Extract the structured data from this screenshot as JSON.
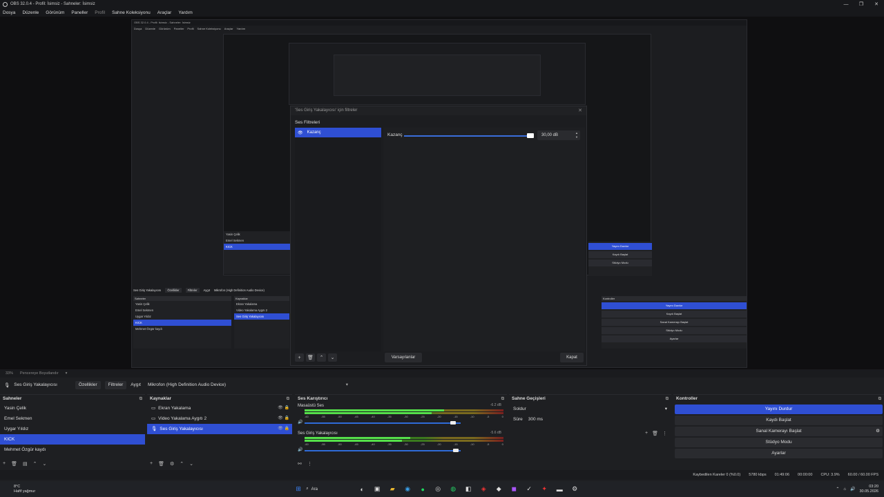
{
  "window": {
    "title": "OBS 32.0.4 - Profil: İsimsiz - Sahneler: İsimsiz"
  },
  "menu": [
    "Dosya",
    "Düzenle",
    "Görünüm",
    "Paneller",
    "Profil",
    "Sahne Koleksiyonu",
    "Araçlar",
    "Yardım"
  ],
  "nested": {
    "title": "OBS 32.0.4 - Profil: İsimsiz - Sahneler: İsimsiz",
    "menu": [
      "Dosya",
      "Düzenle",
      "Görünüm",
      "Paneller",
      "Profil",
      "Sahne Koleksiyonu",
      "Araçlar",
      "Yardım"
    ],
    "source_name": "Ses Giriş Yakalayıcısı",
    "props": "Özellikler",
    "filters": "Filtreler",
    "device_label": "Aygıt",
    "device": "Mikrofon (High Definition Audio Device)",
    "scenes_title": "Sahneler",
    "scenes": [
      "Yasin Çelik",
      "Emel Sekmen",
      "Uygar Yıldız",
      "KICK",
      "Mehmet Özgür kaydı"
    ],
    "sources_title": "Kaynaklar",
    "sources": [
      "Ekran Yakalama",
      "Video Yakalama Aygıtı 2",
      "Ses Giriş Yakalayıcısı"
    ],
    "controls_title": "Kontroller",
    "controls": [
      "Yayını Durdur",
      "Kaydı Başlat",
      "Sanal Kamerayı Başlat",
      "Stüdyo Modu",
      "Ayarlar"
    ],
    "small_dialog_text": "'Ses Giriş Yakalayıcısı' için filtreler"
  },
  "dialog": {
    "title": "'Ses Giriş Yakalayıcısı' için filtreler",
    "section": "Ses Filtreleri",
    "filter_item": "Kazanç",
    "gain_label": "Kazanç",
    "gain_value": "30,00 dB",
    "gain_fraction": 1.0,
    "defaults": "Varsayılanlar",
    "close": "Kapat"
  },
  "zoomrow": {
    "zoom": "33%",
    "mode": "Pencereye Boyutlandır"
  },
  "srcbar": {
    "source": "Ses Giriş Yakalayıcısı",
    "props": "Özellikler",
    "filters": "Filtreler",
    "device_label": "Aygıt",
    "device": "Mikrofon (High Definition Audio Device)"
  },
  "scenes": {
    "title": "Sahneler",
    "items": [
      "Yasin Çelik",
      "Emel Sekmen",
      "Uygar Yıldız",
      "KICK",
      "Mehmet Özgür kaydı"
    ],
    "selected": 3
  },
  "sources": {
    "title": "Kaynaklar",
    "items": [
      "Ekran Yakalama",
      "Video Yakalama Aygıtı 2",
      "Ses Giriş Yakalayıcısı"
    ],
    "selected": 2
  },
  "mixer": {
    "title": "Ses Karıştırıcı",
    "channels": [
      {
        "name": "Masaüstü Ses",
        "db": "-6.2 dB",
        "level": 0.7,
        "volume": 0.95
      },
      {
        "name": "Ses Giriş Yakalayıcısı",
        "db": "-5.6 dB",
        "level": 0.53,
        "volume": 0.97
      }
    ],
    "ticks": [
      "-60",
      "-55",
      "-50",
      "-45",
      "-40",
      "-35",
      "-30",
      "-25",
      "-20",
      "-15",
      "-10",
      "-5",
      "0"
    ]
  },
  "transitions": {
    "title": "Sahne Geçişleri",
    "type": "Soldur",
    "duration_label": "Süre",
    "duration": "300 ms"
  },
  "controls": {
    "title": "Kontroller",
    "items": [
      "Yayını Durdur",
      "Kaydı Başlat",
      "Sanal Kamerayı Başlat",
      "Stüdyo Modu",
      "Ayarlar"
    ]
  },
  "status": {
    "dropped": "Kaybedilen Kareler 0 (%0.0)",
    "bitrate": "5780 kbps",
    "live": "01:49:06",
    "rec": "00:00:00",
    "cpu": "CPU: 3.9%",
    "fps": "60.00 / 60.00 FPS"
  },
  "taskbar": {
    "weather_temp": "8°C",
    "weather_text": "Hafif yağmur",
    "search": "Ara",
    "time": "03:20",
    "date": "30.05.2026"
  }
}
